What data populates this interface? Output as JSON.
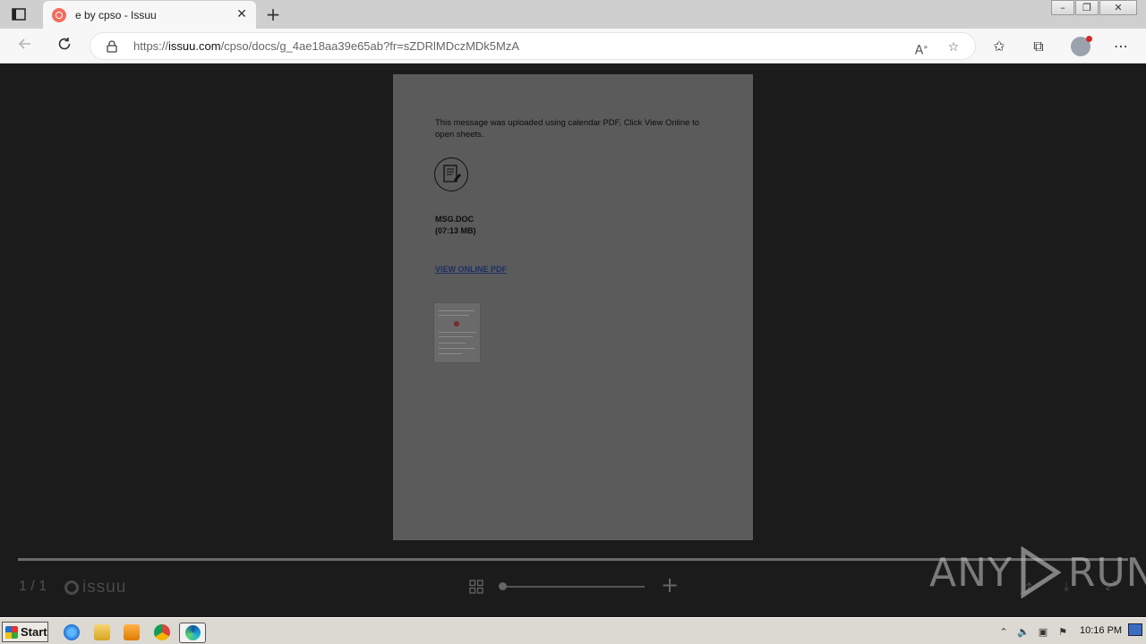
{
  "browser": {
    "tab_title": "e by cpso - Issuu",
    "tab_close": "✕",
    "new_tab": "+",
    "url_host": "issuu.com",
    "url_prefix": "https://",
    "url_path": "/cpso/docs/g_4ae18aa39e65ab?fr=sZDRlMDczMDk5MzA",
    "window_controls": {
      "minimize": "–",
      "restore": "❐",
      "close": "✕"
    }
  },
  "document": {
    "message": "This message was uploaded using calendar PDF, Click View Online to open sheets.",
    "file_name": "MSG.DOC",
    "file_size": "(07:13 MB)",
    "link_label": "VIEW ONLINE PDF"
  },
  "viewer": {
    "page_count": "1 / 1",
    "logo_text": "issuu",
    "zoom_plus": "+"
  },
  "watermark": {
    "left": "ANY",
    "right": "RUN"
  },
  "taskbar": {
    "start_label": "Start",
    "clock": "10:16 PM"
  },
  "colors": {
    "accent_issuu": "#f36d5d",
    "page_bg": "#5b5b5b",
    "viewer_bg": "#1b1b1b"
  }
}
